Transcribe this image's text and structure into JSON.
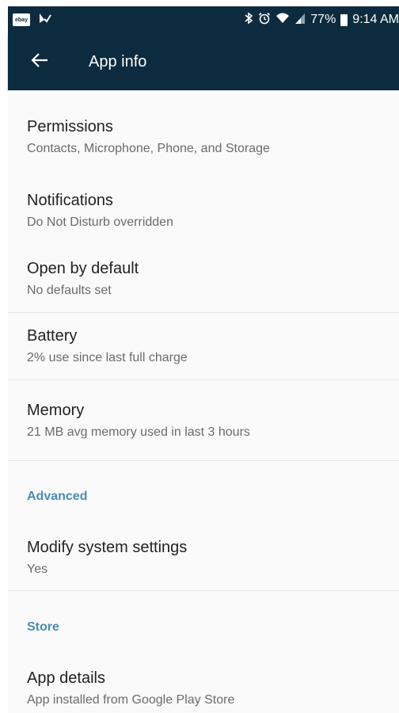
{
  "status_bar": {
    "notif_icons": [
      "ebay-icon",
      "check-icon"
    ],
    "ebay_text": "ebay",
    "right_icons": [
      "bluetooth-icon",
      "alarm-icon",
      "wifi-icon",
      "signal-icon"
    ],
    "battery_percent": "77%",
    "time": "9:14 AM"
  },
  "app_bar": {
    "title": "App info",
    "back_icon": "arrow-back-icon",
    "background": "#0d2b3e"
  },
  "rows": {
    "permissions": {
      "title": "Permissions",
      "subtitle": "Contacts, Microphone, Phone, and Storage"
    },
    "notifications": {
      "title": "Notifications",
      "subtitle": "Do Not Disturb overridden"
    },
    "open_by_default": {
      "title": "Open by default",
      "subtitle": "No defaults set"
    },
    "battery": {
      "title": "Battery",
      "subtitle": "2% use since last full charge"
    },
    "memory": {
      "title": "Memory",
      "subtitle": "21 MB avg memory used in last 3 hours"
    },
    "modify_system": {
      "title": "Modify system settings",
      "subtitle": "Yes"
    },
    "app_details": {
      "title": "App details",
      "subtitle": "App installed from Google Play Store"
    }
  },
  "sections": {
    "advanced": "Advanced",
    "store": "Store"
  },
  "colors": {
    "accent": "#4a8db5",
    "toolbar": "#0d2b3e"
  }
}
